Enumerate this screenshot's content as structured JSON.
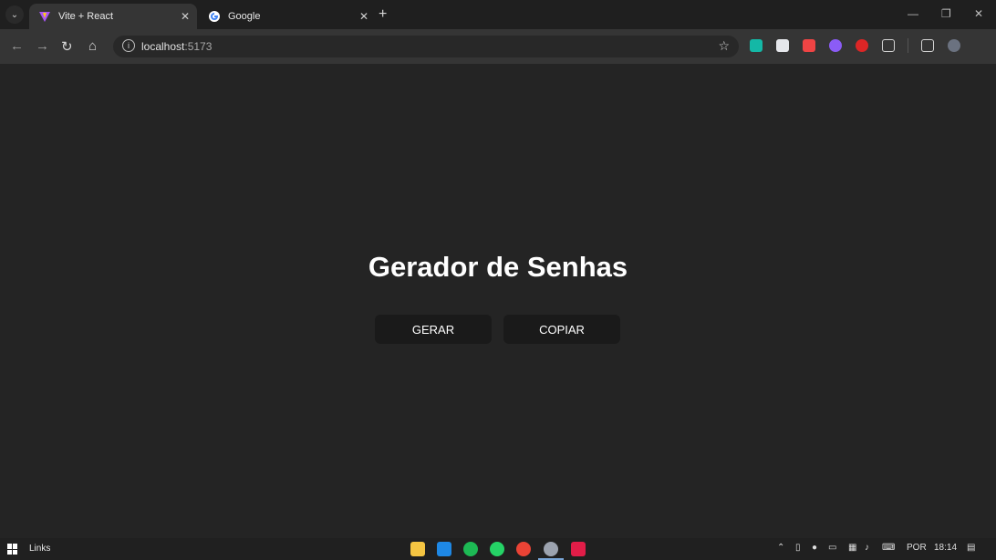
{
  "browser": {
    "tabs": [
      {
        "label": "Vite + React",
        "active": true
      },
      {
        "label": "Google",
        "active": false
      }
    ],
    "url_host": "localhost",
    "url_port": ":5173"
  },
  "page": {
    "title": "Gerador de Senhas",
    "buttons": {
      "generate": "GERAR",
      "copy": "COPIAR"
    }
  },
  "taskbar": {
    "links": "Links",
    "language": "POR",
    "time": "18:14"
  },
  "colors": {
    "background": "#242424",
    "button": "#1a1a1a",
    "text": "#ffffff"
  }
}
